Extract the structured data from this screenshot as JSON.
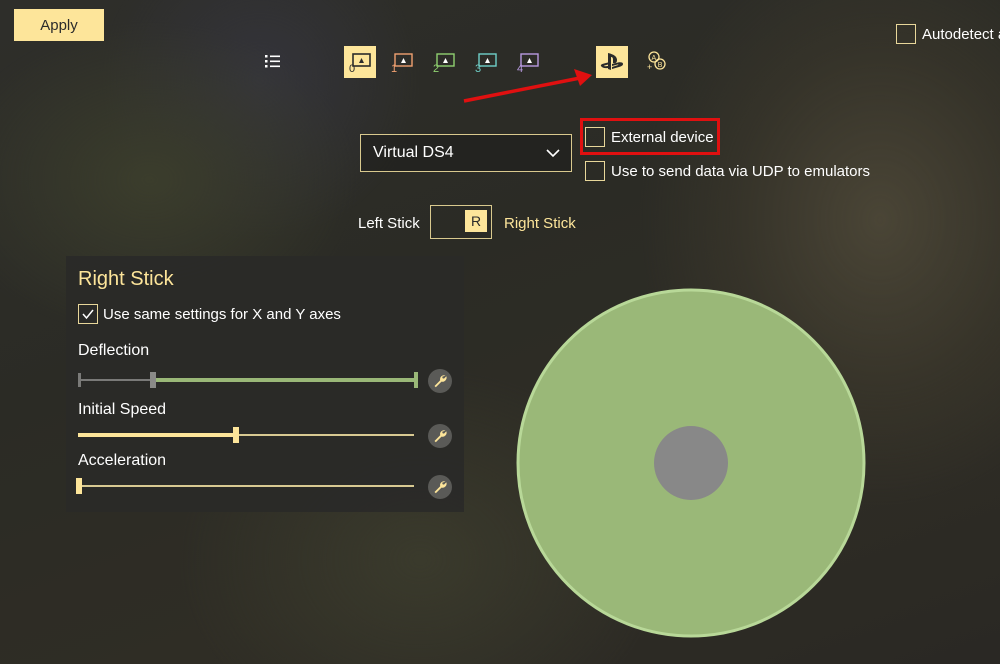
{
  "toolbar": {
    "apply_label": "Apply",
    "autodetect_label": "Autodetect a",
    "autodetect_checked": false,
    "controller_slots": [
      {
        "label": "0",
        "active": true
      },
      {
        "label": "1",
        "active": false
      },
      {
        "label": "2",
        "active": false
      },
      {
        "label": "3",
        "active": false
      },
      {
        "label": "4",
        "active": false
      }
    ],
    "icons": [
      "list-icon",
      "playstation-icon",
      "xbox-buttons-icon"
    ],
    "playstation_active": true
  },
  "device": {
    "selected": "Virtual DS4",
    "external_device_label": "External device",
    "external_device_checked": false,
    "udp_label": "Use to send data via UDP to emulators",
    "udp_checked": false
  },
  "stick_toggle": {
    "left_label": "Left Stick",
    "right_label": "Right Stick",
    "knob_label": "R",
    "selected": "Right Stick"
  },
  "panel": {
    "title": "Right Stick",
    "same_settings_label": "Use same settings for X and Y axes",
    "same_settings_checked": true,
    "sliders": {
      "deflection": {
        "label": "Deflection",
        "range_low": 0.22,
        "range_high": 1.0
      },
      "initial_speed": {
        "label": "Initial Speed",
        "value": 0.47
      },
      "acceleration": {
        "label": "Acceleration",
        "value": 0.0
      }
    }
  },
  "colors": {
    "accent": "#fde59a",
    "green": "#9ab878",
    "green_border": "#b8d898",
    "dot": "#888888",
    "highlight": "#e01010"
  }
}
